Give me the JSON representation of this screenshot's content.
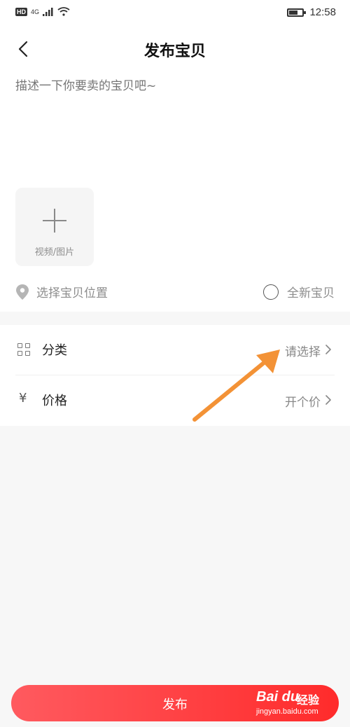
{
  "status_bar": {
    "hd": "HD",
    "network": "4G",
    "time": "12:58"
  },
  "header": {
    "title": "发布宝贝"
  },
  "description": {
    "placeholder": "描述一下你要卖的宝贝吧~"
  },
  "media": {
    "label": "视频/图片"
  },
  "location": {
    "label": "选择宝贝位置"
  },
  "condition": {
    "label": "全新宝贝"
  },
  "options": [
    {
      "label": "分类",
      "value": "请选择",
      "icon": "grid-icon"
    },
    {
      "label": "价格",
      "value": "开个价",
      "icon": "yen-icon",
      "icon_glyph": "¥"
    }
  ],
  "publish_button": {
    "label": "发布"
  },
  "watermark": {
    "logo": "Bai du",
    "name": "经验",
    "url": "jingyan.baidu.com"
  },
  "colors": {
    "primary_red": "#ff3b3b",
    "annotation_arrow": "#f39236"
  }
}
